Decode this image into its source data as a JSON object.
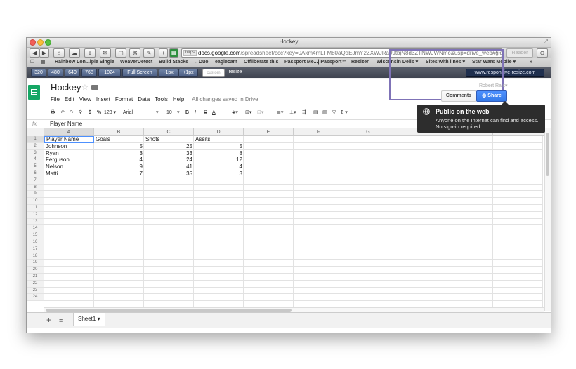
{
  "window": {
    "title": "Hockey",
    "resize_glyph": "⤢"
  },
  "nav": {
    "back": "◀",
    "forward": "▶",
    "buttons": [
      "⌂",
      "☁",
      "⇪",
      "✉",
      "▢",
      "⌘",
      "✎",
      "+",
      "▦"
    ],
    "url_scheme": "https",
    "url_host": "docs.google.com",
    "url_path": "/spreadsheet/ccc?key=0Akm4mLFM80aQdEJmY2ZXWJRa09tbjN8d3ZTNWJWNmc&usp=drive_web#gid=0",
    "reload": "C",
    "reader": "Reader",
    "download": "⊙"
  },
  "bookmarks": {
    "icons": [
      "☐",
      "▦"
    ],
    "items": [
      "Rainbow Lon...iple Single",
      "WeaverDetect",
      "Build Stacks",
      "→ Duo",
      "eaglecam",
      "Offliberate this",
      "Passport Me...| Passport™",
      "Resizer",
      "Wisconsin Dells ▾",
      "Sites with lines ▾",
      "Star Wars Mobile ▾"
    ],
    "more": "»"
  },
  "resize_bar": {
    "buttons": [
      "320",
      "480",
      "640",
      "768",
      "1024",
      "Full Screen",
      "-1px",
      "+1px"
    ],
    "custom_placeholder": "custom",
    "resize": "resize",
    "site": "www.responsive-resize.com"
  },
  "doc": {
    "title": "Hockey",
    "star": "☆",
    "menu": [
      "File",
      "Edit",
      "View",
      "Insert",
      "Format",
      "Data",
      "Tools",
      "Help"
    ],
    "saved_status": "All changes saved in Drive",
    "faint_user": "Robert Rais▾"
  },
  "toolbar": {
    "currency": "$",
    "percent": "%",
    "number_format": "123 ▾",
    "font": "Arial",
    "font_arrow": "▾",
    "size": "10",
    "size_arrow": "▾",
    "bold": "B",
    "italic": "I",
    "strike": "S",
    "textcolor": "A",
    "sigma": "Σ ▾"
  },
  "formula_bar": {
    "label": "fx",
    "value": "Player Name"
  },
  "sheet": {
    "columns": [
      "A",
      "B",
      "C",
      "D",
      "E",
      "F",
      "G",
      "H",
      "I"
    ],
    "row_numbers": [
      "1",
      "2",
      "3",
      "4",
      "5",
      "6",
      "7",
      "8",
      "9",
      "10",
      "11",
      "12",
      "13",
      "14",
      "15",
      "16",
      "17",
      "18",
      "19",
      "20",
      "21",
      "22",
      "23",
      "24"
    ],
    "headers": [
      "Player Name",
      "Goals",
      "Shots",
      "Assits"
    ],
    "rows": [
      [
        "Johnson",
        "5",
        "25",
        "5"
      ],
      [
        "Ryan",
        "3",
        "33",
        "8"
      ],
      [
        "Ferguson",
        "4",
        "24",
        "12"
      ],
      [
        "Nelson",
        "9",
        "41",
        "4"
      ],
      [
        "Matti",
        "7",
        "35",
        "3"
      ]
    ]
  },
  "sheet_tabs": {
    "add": "+",
    "list": "≡",
    "active": "Sheet1 ▾"
  },
  "share": {
    "comments": "Comments",
    "share": "Share",
    "tooltip_title": "Public on the web",
    "tooltip_body": "Anyone on the Internet can find and access. No sign-in required."
  },
  "colors": {
    "accent": "#4d90fe",
    "sheets_green": "#16a765",
    "highlight_frame": "#7f73b7"
  }
}
